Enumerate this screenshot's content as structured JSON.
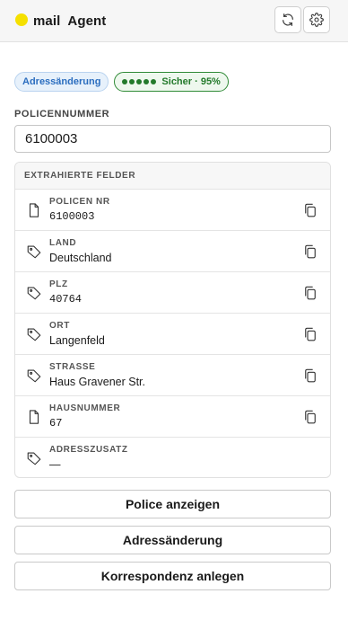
{
  "header": {
    "title": "mail  Agent",
    "logo_color": "#f5e000",
    "refresh_icon": "refresh-icon",
    "settings_icon": "gear-icon"
  },
  "badges": {
    "type": "Adressänderung",
    "confidence": "Sicher · 95%",
    "confidence_dots": 5
  },
  "policy": {
    "label": "POLICENNUMMER",
    "value": "6100003"
  },
  "fields": {
    "title": "EXTRAHIERTE FELDER",
    "items": [
      {
        "label": "POLICEN NR",
        "value": "6100003",
        "icon": "document-icon",
        "mono": true,
        "copyable": true
      },
      {
        "label": "LAND",
        "value": "Deutschland",
        "icon": "tag-icon",
        "mono": false,
        "copyable": true
      },
      {
        "label": "PLZ",
        "value": "40764",
        "icon": "tag-icon",
        "mono": true,
        "copyable": true
      },
      {
        "label": "ORT",
        "value": "Langenfeld",
        "icon": "tag-icon",
        "mono": false,
        "copyable": true
      },
      {
        "label": "STRASSE",
        "value": "Haus Gravener Str.",
        "icon": "tag-icon",
        "mono": false,
        "copyable": true
      },
      {
        "label": "HAUSNUMMER",
        "value": "67",
        "icon": "document-icon",
        "mono": true,
        "copyable": true
      },
      {
        "label": "ADRESSZUSATZ",
        "value": "—",
        "icon": "tag-icon",
        "mono": false,
        "copyable": false
      }
    ]
  },
  "actions": {
    "show_policy": "Police anzeigen",
    "address_change": "Adressänderung",
    "create_correspondence": "Korrespondenz anlegen"
  },
  "colors": {
    "accent_blue": "#2c6ebf",
    "confidence_green": "#237a2b"
  }
}
